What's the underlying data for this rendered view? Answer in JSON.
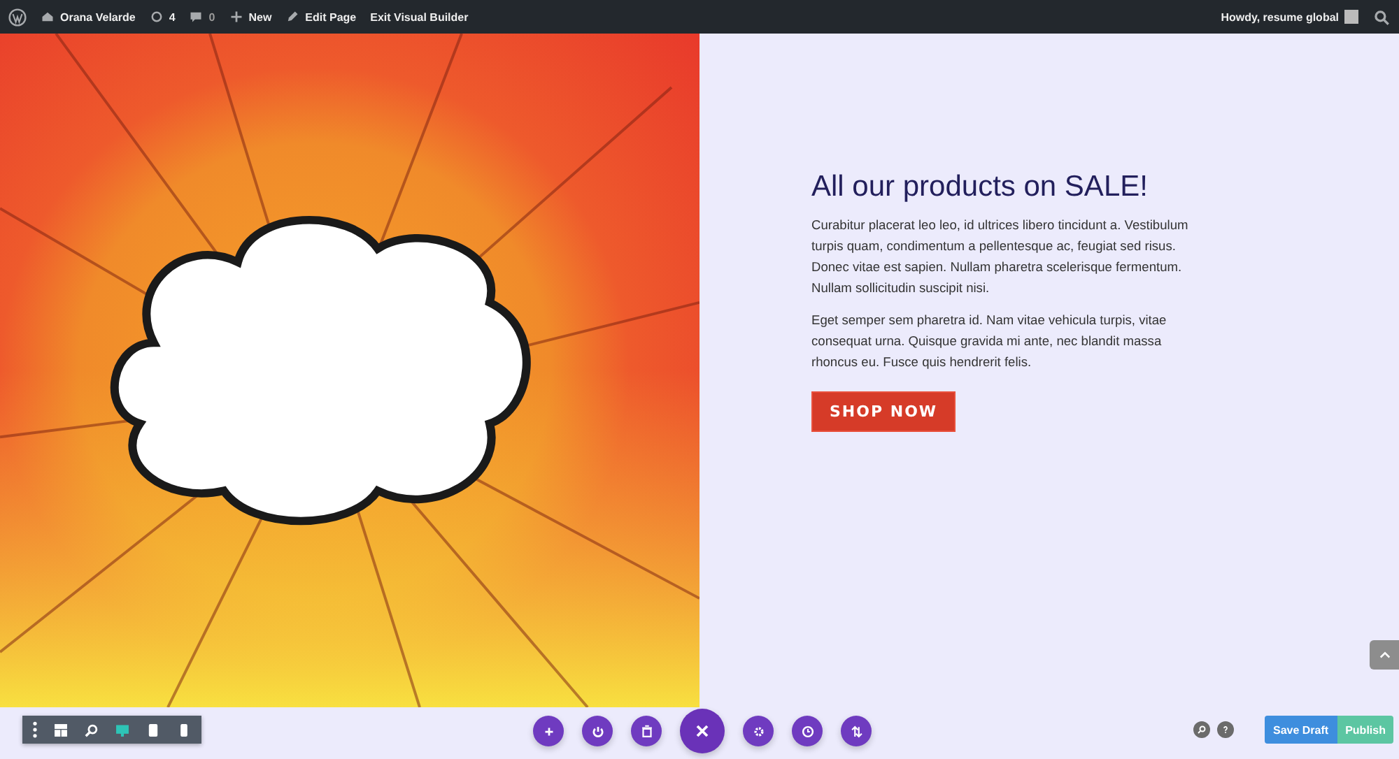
{
  "admin_bar": {
    "site_name": "Orana Velarde",
    "updates_count": "4",
    "comments_count": "0",
    "new_label": "New",
    "edit_label": "Edit Page",
    "exit_label": "Exit Visual Builder",
    "greeting": "Howdy, resume global"
  },
  "hero": {
    "heading": "All our products on SALE!",
    "paragraphs": [
      "Curabitur placerat leo leo, id ultrices libero tincidunt a. Vestibulum turpis quam, condimentum a pellentesque ac, feugiat sed risus. Donec vitae est sapien. Nullam pharetra scelerisque fermentum. Nullam sollicitudin suscipit nisi.",
      "Eget semper sem pharetra id. Nam vitae vehicula turpis, vitae consequat urna. Quisque gravida mi ante, nec blandit massa rhoncus eu. Fusce quis hendrerit felis."
    ],
    "button": "SHOP NOW"
  },
  "view_modes": [
    {
      "kind": "wireframe",
      "selected": false
    },
    {
      "kind": "zoom",
      "selected": false
    },
    {
      "kind": "desktop",
      "selected": true
    },
    {
      "kind": "tablet",
      "selected": false
    },
    {
      "kind": "phone",
      "selected": false
    }
  ],
  "actions": {
    "save_draft": "Save Draft",
    "publish": "Publish"
  }
}
